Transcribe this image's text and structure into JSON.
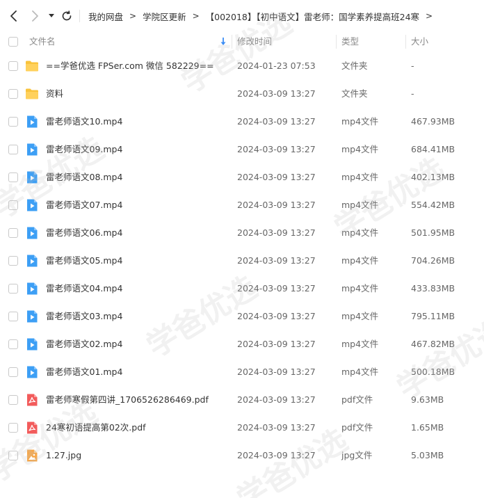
{
  "nav": {
    "back_icon": "chevron-left-icon",
    "forward_icon": "chevron-right-icon",
    "history_icon": "caret-down-icon",
    "refresh_icon": "refresh-icon"
  },
  "breadcrumb": {
    "items": [
      "我的网盘",
      "学院区更新",
      "【002018】【初中语文】雷老师：国学素养提高班24寒"
    ],
    "separator": ">"
  },
  "header": {
    "name": "文件名",
    "modified": "修改时间",
    "type": "类型",
    "size": "大小"
  },
  "files": [
    {
      "icon": "folder-icon",
      "name": "==学爸优选 FPSer.com 微信 582229==",
      "date": "2024-01-23 07:53",
      "type": "文件夹",
      "size": "-"
    },
    {
      "icon": "folder-icon",
      "name": "资料",
      "date": "2024-03-09 13:27",
      "type": "文件夹",
      "size": "-"
    },
    {
      "icon": "video-icon",
      "name": "雷老师语文10.mp4",
      "date": "2024-03-09 13:27",
      "type": "mp4文件",
      "size": "467.93MB"
    },
    {
      "icon": "video-icon",
      "name": "雷老师语文09.mp4",
      "date": "2024-03-09 13:27",
      "type": "mp4文件",
      "size": "684.41MB"
    },
    {
      "icon": "video-icon",
      "name": "雷老师语文08.mp4",
      "date": "2024-03-09 13:27",
      "type": "mp4文件",
      "size": "402.13MB"
    },
    {
      "icon": "video-icon",
      "name": "雷老师语文07.mp4",
      "date": "2024-03-09 13:27",
      "type": "mp4文件",
      "size": "554.42MB"
    },
    {
      "icon": "video-icon",
      "name": "雷老师语文06.mp4",
      "date": "2024-03-09 13:27",
      "type": "mp4文件",
      "size": "501.95MB"
    },
    {
      "icon": "video-icon",
      "name": "雷老师语文05.mp4",
      "date": "2024-03-09 13:27",
      "type": "mp4文件",
      "size": "704.26MB"
    },
    {
      "icon": "video-icon",
      "name": "雷老师语文04.mp4",
      "date": "2024-03-09 13:27",
      "type": "mp4文件",
      "size": "433.83MB"
    },
    {
      "icon": "video-icon",
      "name": "雷老师语文03.mp4",
      "date": "2024-03-09 13:27",
      "type": "mp4文件",
      "size": "795.11MB"
    },
    {
      "icon": "video-icon",
      "name": "雷老师语文02.mp4",
      "date": "2024-03-09 13:27",
      "type": "mp4文件",
      "size": "467.82MB"
    },
    {
      "icon": "video-icon",
      "name": "雷老师语文01.mp4",
      "date": "2024-03-09 13:27",
      "type": "mp4文件",
      "size": "500.18MB"
    },
    {
      "icon": "pdf-icon",
      "name": "雷老师寒假第四讲_1706526286469.pdf",
      "date": "2024-03-09 13:27",
      "type": "pdf文件",
      "size": "9.63MB"
    },
    {
      "icon": "pdf-icon",
      "name": "24寒初语提高第02次.pdf",
      "date": "2024-03-09 13:27",
      "type": "pdf文件",
      "size": "1.65MB"
    },
    {
      "icon": "image-icon",
      "name": "1.27.jpg",
      "date": "2024-03-09 13:27",
      "type": "jpg文件",
      "size": "5.03MB"
    }
  ],
  "colors": {
    "folder": "#f9c33c",
    "video": "#3d9ff5",
    "pdf": "#f25b5b",
    "image": "#f6a74a",
    "sort_arrow": "#3d8ef5"
  },
  "watermark": "学爸优选"
}
